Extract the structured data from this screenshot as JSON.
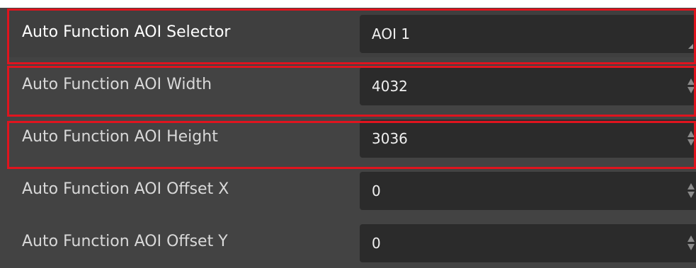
{
  "colors": {
    "panel_background": "#434343",
    "value_field_background": "#2b2b2b",
    "highlight_border": "#e0141e",
    "label_text": "#d9d9d9",
    "value_text": "#f0f0f0"
  },
  "properties": [
    {
      "label": "Auto Function AOI Selector",
      "value": "AOI 1",
      "control": "dropdown",
      "highlighted": true,
      "selected": true
    },
    {
      "label": "Auto Function AOI Width",
      "value": "4032",
      "control": "spinner",
      "highlighted": true,
      "selected": false
    },
    {
      "label": "Auto Function AOI Height",
      "value": "3036",
      "control": "spinner",
      "highlighted": true,
      "selected": false
    },
    {
      "label": "Auto Function AOI Offset X",
      "value": "0",
      "control": "spinner",
      "highlighted": false,
      "selected": false
    },
    {
      "label": "Auto Function AOI Offset Y",
      "value": "0",
      "control": "spinner",
      "highlighted": false,
      "selected": false
    }
  ]
}
